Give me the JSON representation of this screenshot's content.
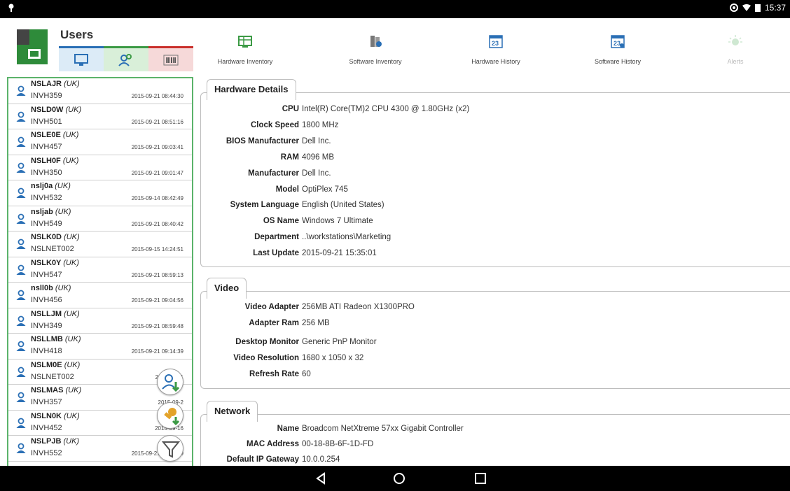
{
  "status": {
    "time": "15:37"
  },
  "users_panel": {
    "title": "Users",
    "users": [
      {
        "name": "NSLAJR",
        "loc": "(UK)",
        "device": "INVH359",
        "date": "2015-09-21 08:44:30"
      },
      {
        "name": "NSLD0W",
        "loc": "(UK)",
        "device": "INVH501",
        "date": "2015-09-21 08:51:16"
      },
      {
        "name": "NSLE0E",
        "loc": "(UK)",
        "device": "INVH457",
        "date": "2015-09-21 09:03:41"
      },
      {
        "name": "NSLH0F",
        "loc": "(UK)",
        "device": "INVH350",
        "date": "2015-09-21 09:01:47"
      },
      {
        "name": "nslj0a",
        "loc": "(UK)",
        "device": "INVH532",
        "date": "2015-09-14 08:42:49"
      },
      {
        "name": "nsljab",
        "loc": "(UK)",
        "device": "INVH549",
        "date": "2015-09-21 08:40:42"
      },
      {
        "name": "NSLK0D",
        "loc": "(UK)",
        "device": "NSLNET002",
        "date": "2015-09-15 14:24:51"
      },
      {
        "name": "NSLK0Y",
        "loc": "(UK)",
        "device": "INVH547",
        "date": "2015-09-21 08:59:13"
      },
      {
        "name": "nsll0b",
        "loc": "(UK)",
        "device": "INVH456",
        "date": "2015-09-21 09:04:56"
      },
      {
        "name": "NSLLJM",
        "loc": "(UK)",
        "device": "INVH349",
        "date": "2015-09-21 08:59:48"
      },
      {
        "name": "NSLLMB",
        "loc": "(UK)",
        "device": "INVH418",
        "date": "2015-09-21 09:14:39"
      },
      {
        "name": "NSLM0E",
        "loc": "(UK)",
        "device": "NSLNET002",
        "date": "2015-09-11"
      },
      {
        "name": "NSLMAS",
        "loc": "(UK)",
        "device": "INVH357",
        "date": "2015-09-2"
      },
      {
        "name": "NSLN0K",
        "loc": "(UK)",
        "device": "INVH452",
        "date": "2015-09-16"
      },
      {
        "name": "NSLPJB",
        "loc": "(UK)",
        "device": "INVH552",
        "date": "2015-09-21 09:02:59"
      }
    ]
  },
  "toolbar": {
    "hardware_inventory": "Hardware Inventory",
    "software_inventory": "Software Inventory",
    "hardware_history": "Hardware History",
    "software_history": "Software History",
    "alerts": "Alerts"
  },
  "hardware": {
    "title": "Hardware Details",
    "rows": [
      {
        "k": "CPU",
        "v": "Intel(R) Core(TM)2 CPU          4300  @ 1.80GHz (x2)"
      },
      {
        "k": "Clock Speed",
        "v": "1800 MHz"
      },
      {
        "k": "BIOS Manufacturer",
        "v": "Dell Inc."
      },
      {
        "k": "RAM",
        "v": "4096 MB"
      },
      {
        "k": "Manufacturer",
        "v": "Dell Inc."
      },
      {
        "k": "Model",
        "v": "OptiPlex 745"
      },
      {
        "k": "System Language",
        "v": "English (United States)"
      },
      {
        "k": "OS Name",
        "v": "Windows 7 Ultimate"
      },
      {
        "k": "Department",
        "v": "..\\workstations\\Marketing"
      },
      {
        "k": "Last Update",
        "v": "2015-09-21 15:35:01"
      }
    ]
  },
  "video": {
    "title": "Video",
    "rows": [
      {
        "k": "Video Adapter",
        "v": "256MB ATI Radeon X1300PRO"
      },
      {
        "k": "Adapter Ram",
        "v": "256 MB"
      },
      {
        "k": "Desktop Monitor",
        "v": "Generic PnP Monitor"
      },
      {
        "k": "Video Resolution",
        "v": "1680 x 1050 x 32"
      },
      {
        "k": "Refresh Rate",
        "v": "60"
      }
    ]
  },
  "network": {
    "title": "Network",
    "rows": [
      {
        "k": "Name",
        "v": "Broadcom NetXtreme 57xx Gigabit Controller"
      },
      {
        "k": "MAC Address",
        "v": "00-18-8B-6F-1D-FD"
      },
      {
        "k": "Default IP Gateway",
        "v": "10.0.0.254"
      }
    ]
  }
}
